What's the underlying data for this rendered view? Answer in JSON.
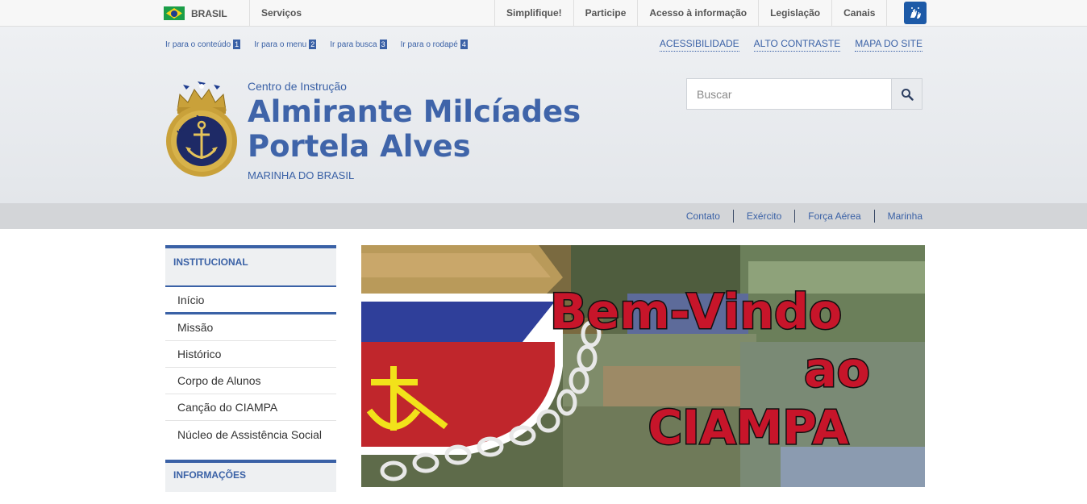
{
  "govbar": {
    "brasil_label": "BRASIL",
    "servicos_label": "Serviços",
    "links": [
      "Simplifique!",
      "Participe",
      "Acesso à informação",
      "Legislação",
      "Canais"
    ],
    "libras_icon": "hands-sign-language-icon"
  },
  "skip_links": [
    {
      "label": "Ir para o conteúdo",
      "key": "1"
    },
    {
      "label": "Ir para o menu",
      "key": "2"
    },
    {
      "label": "Ir para busca",
      "key": "3"
    },
    {
      "label": "Ir para o rodapé",
      "key": "4"
    }
  ],
  "access_links": [
    "ACESSIBILIDADE",
    "ALTO CONTRASTE",
    "MAPA DO SITE"
  ],
  "header": {
    "pretitle": "Centro de Instrução",
    "title_line1": "Almirante Milcíades",
    "title_line2": "Portela Alves",
    "subtitle": "MARINHA DO BRASIL",
    "logo_text": "MARINHA DO BRASIL"
  },
  "search": {
    "placeholder": "Buscar"
  },
  "service_links": [
    "Contato",
    "Exército",
    "Força Aérea",
    "Marinha"
  ],
  "sidebar": {
    "section1": "INSTITUCIONAL",
    "items": [
      "Início",
      "Missão",
      "Histórico",
      "Corpo de Alunos",
      "Canção do CIAMPA",
      "Núcleo de Assistência Social"
    ],
    "section2": "INFORMAÇÕES"
  },
  "banner": {
    "line1": "Bem-Vindo",
    "line2": "ao",
    "line3": "CIAMPA"
  },
  "colors": {
    "brand_blue": "#3a61a6",
    "servbar": "#d3d5d8"
  }
}
